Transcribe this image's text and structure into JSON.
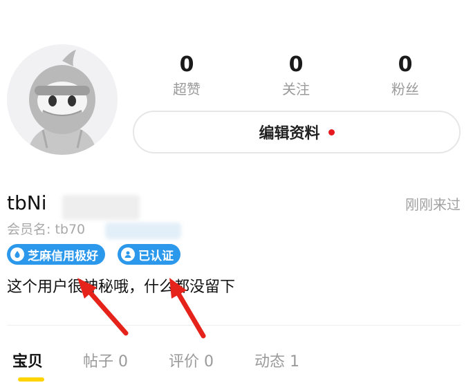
{
  "profile": {
    "avatar_icon": "ninja-avatar-icon",
    "name": "tbNi",
    "member_label": "会员名: tb70",
    "last_seen": "刚刚来过",
    "bio": "这个用户很神秘哦，什么都没留下"
  },
  "stats": [
    {
      "value": "0",
      "label": "超赞"
    },
    {
      "value": "0",
      "label": "关注"
    },
    {
      "value": "0",
      "label": "粉丝"
    }
  ],
  "edit_button": {
    "label": "编辑资料",
    "dot_color": "#e5191f"
  },
  "badges": [
    {
      "label": "芝麻信用极好",
      "icon": "sesame-drop-icon"
    },
    {
      "label": "已认证",
      "icon": "verified-person-icon"
    }
  ],
  "tabs": [
    {
      "label": "宝贝"
    },
    {
      "label": "帖子 0"
    },
    {
      "label": "评价 0"
    },
    {
      "label": "动态 1"
    }
  ],
  "colors": {
    "accent_blue": "#2c98ec",
    "tab_underline": "#ffd400",
    "arrow_red": "#e5231b"
  }
}
